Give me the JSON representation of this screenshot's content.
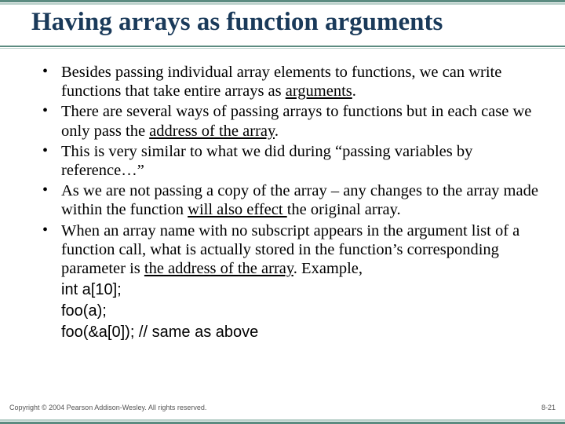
{
  "title": "Having arrays as function arguments",
  "bullets": {
    "b1a": "Besides passing individual array elements to functions, we can write functions that take entire arrays as ",
    "b1u": "arguments",
    "b1b": ".",
    "b2a": "There are several ways of passing arrays to functions but in each case we only pass the ",
    "b2u": "address of the array",
    "b2b": ".",
    "b3": "This is very similar to what we did during “passing variables by reference…”",
    "b4a": "As we are not passing a copy of the array – any changes to the array made within the function ",
    "b4u": "will also effect ",
    "b4b": "the original array.",
    "b5a": "When an array name with no subscript appears in the argument list of a function call, what is actually stored in the function’s corresponding parameter is ",
    "b5u": "the address of the array",
    "b5b": ". Example,"
  },
  "code": {
    "l1": "int a[10];",
    "l2": "foo(a);",
    "l3": "foo(&a[0]); // same as above"
  },
  "footer": {
    "copyright": "Copyright © 2004 Pearson Addison-Wesley. All rights reserved.",
    "page": "8-21"
  }
}
